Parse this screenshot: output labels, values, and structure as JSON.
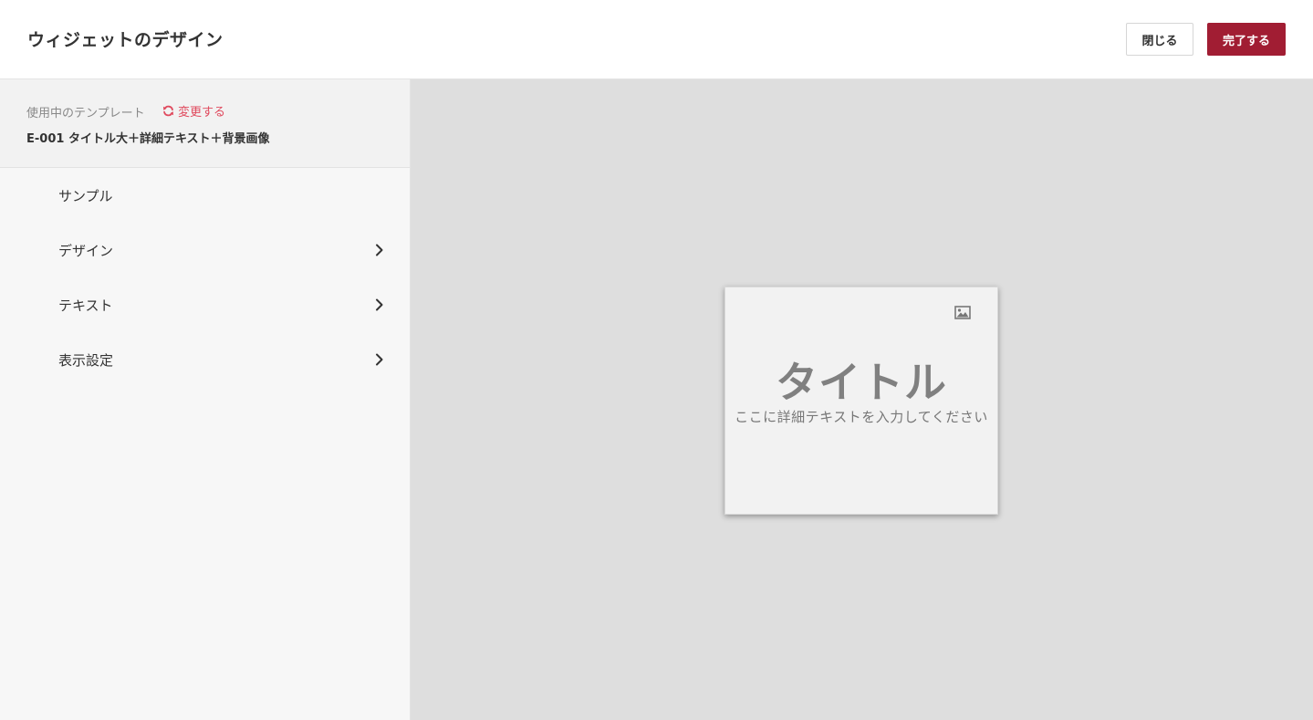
{
  "header": {
    "title": "ウィジェットのデザイン",
    "close_label": "閉じる",
    "done_label": "完了する"
  },
  "sidebar": {
    "template": {
      "using_label": "使用中のテンプレート",
      "change_label": "変更する",
      "name": "E-001 タイトル大＋詳細テキスト＋背景画像"
    },
    "items": [
      {
        "label": "サンプル",
        "has_chevron": false
      },
      {
        "label": "デザイン",
        "has_chevron": true
      },
      {
        "label": "テキスト",
        "has_chevron": true
      },
      {
        "label": "表示設定",
        "has_chevron": true
      }
    ]
  },
  "preview": {
    "title": "タイトル",
    "detail_text": "ここに詳細テキストを入力してください",
    "image_icon": "image-icon"
  },
  "colors": {
    "accent": "#a11d33",
    "link": "#e04a5e",
    "canvas_bg": "#dedede",
    "sidebar_bg": "#f7f7f7"
  }
}
